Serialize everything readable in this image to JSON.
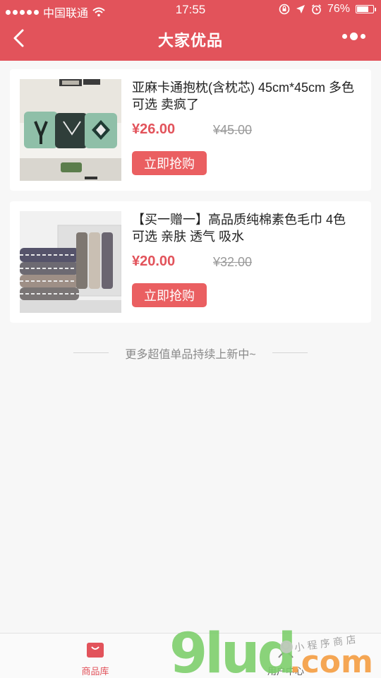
{
  "status_bar": {
    "carrier": "中国联通",
    "time": "17:55",
    "battery": "76%",
    "battery_level": 0.76
  },
  "nav": {
    "title": "大家优品",
    "back_icon": "chevron-left-icon",
    "menu_icon": "more-dots-icon"
  },
  "products": [
    {
      "name": "亚麻卡通抱枕(含枕芯) 45cm*45cm 多色可选 卖疯了",
      "price": "¥26.00",
      "original_price": "¥45.00",
      "button": "立即抢购",
      "image": "pillow-image"
    },
    {
      "name": "【买一赠一】高品质纯棉素色毛巾 4色可选 亲肤 透气 吸水",
      "price": "¥20.00",
      "original_price": "¥32.00",
      "button": "立即抢购",
      "image": "towel-image"
    }
  ],
  "footer_note": "更多超值单品持续上新中~",
  "tabs": [
    {
      "label": "商品库",
      "icon": "shopping-bag-icon",
      "active": true
    },
    {
      "label": "用户中心",
      "icon": "user-icon",
      "active": false
    }
  ],
  "watermark": {
    "text": "9lud.com",
    "subtext": "小程序商店"
  },
  "colors": {
    "accent": "#e2535b",
    "button": "#ea5f61",
    "background": "#f7f7f7"
  }
}
